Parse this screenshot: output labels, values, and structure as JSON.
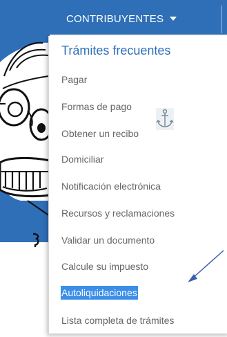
{
  "navbar": {
    "label": "CONTRIBUYENTES",
    "caret_icon": "caret-down-icon",
    "color": "#2f6fb7"
  },
  "menu": {
    "header": "Trámites frecuentes",
    "items": [
      "Pagar",
      "Formas de pago",
      "Obtener un recibo",
      "Domiciliar",
      "Notificación electrónica",
      "Recursos y reclamaciones",
      "Validar un documento",
      "Calcule su impuesto",
      "Autoliquidaciones",
      "Lista completa de trámites"
    ],
    "selected_item": "Autoliquidaciones",
    "selected_color": "#3b8ee8"
  },
  "icons": {
    "anchor": "anchor-icon",
    "annotation_arrow": "arrow-annotation-icon"
  },
  "accent_color": "#2f6fb7"
}
